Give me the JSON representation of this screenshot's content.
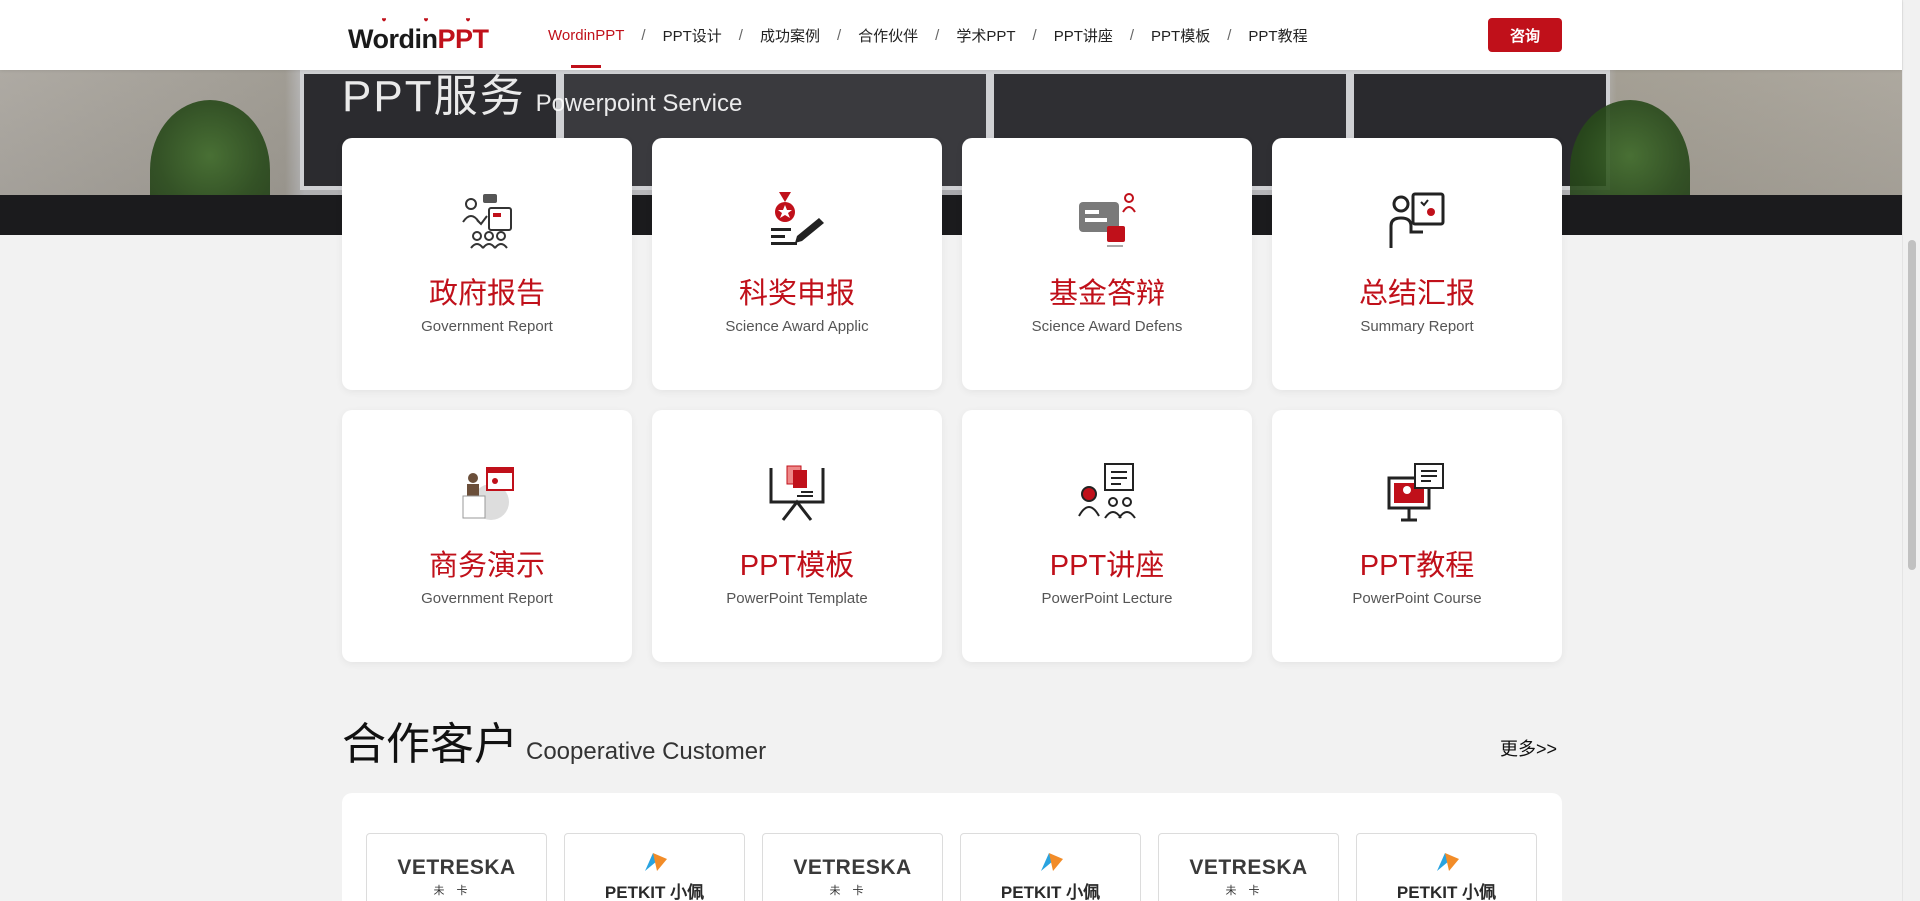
{
  "header": {
    "logo": {
      "word_main": "Wordin",
      "word_accent": "PPT"
    },
    "nav": [
      {
        "label": "WordinPPT",
        "active": true
      },
      {
        "label": "PPT设计"
      },
      {
        "label": "成功案例"
      },
      {
        "label": "合作伙伴"
      },
      {
        "label": "学术PPT"
      },
      {
        "label": "PPT讲座"
      },
      {
        "label": "PPT模板"
      },
      {
        "label": "PPT教程"
      }
    ],
    "separator": "/",
    "consult_label": "咨询"
  },
  "hero": {
    "title": "PPT服务",
    "subtitle": "Powerpoint Service"
  },
  "services": [
    {
      "title": "政府报告",
      "subtitle": "Government Report",
      "icon": "government-report-icon"
    },
    {
      "title": "科奖申报",
      "subtitle": "Science Award Applic",
      "icon": "award-medal-icon"
    },
    {
      "title": "基金答辩",
      "subtitle": "Science Award Defens",
      "icon": "chat-defense-icon"
    },
    {
      "title": "总结汇报",
      "subtitle": "Summary Report",
      "icon": "presenter-board-icon"
    },
    {
      "title": "商务演示",
      "subtitle": "Government Report",
      "icon": "business-presentation-icon"
    },
    {
      "title": "PPT模板",
      "subtitle": "PowerPoint Template",
      "icon": "template-easel-icon"
    },
    {
      "title": "PPT讲座",
      "subtitle": "PowerPoint Lecture",
      "icon": "lecture-audience-icon"
    },
    {
      "title": "PPT教程",
      "subtitle": "PowerPoint Course",
      "icon": "online-course-icon"
    }
  ],
  "customers": {
    "title": "合作客户",
    "subtitle": "Cooperative Customer",
    "more_label": "更多>>",
    "logos": [
      {
        "brand": "VETRESKA",
        "sub": "未卡",
        "type": "vetreska"
      },
      {
        "brand": "PETKIT 小佩",
        "type": "petkit"
      },
      {
        "brand": "VETRESKA",
        "sub": "未卡",
        "type": "vetreska"
      },
      {
        "brand": "PETKIT 小佩",
        "type": "petkit"
      },
      {
        "brand": "VETRESKA",
        "sub": "未卡",
        "type": "vetreska"
      },
      {
        "brand": "PETKIT 小佩",
        "type": "petkit"
      }
    ]
  },
  "colors": {
    "accent": "#c0101a",
    "page_bg": "#f2f2f2"
  }
}
